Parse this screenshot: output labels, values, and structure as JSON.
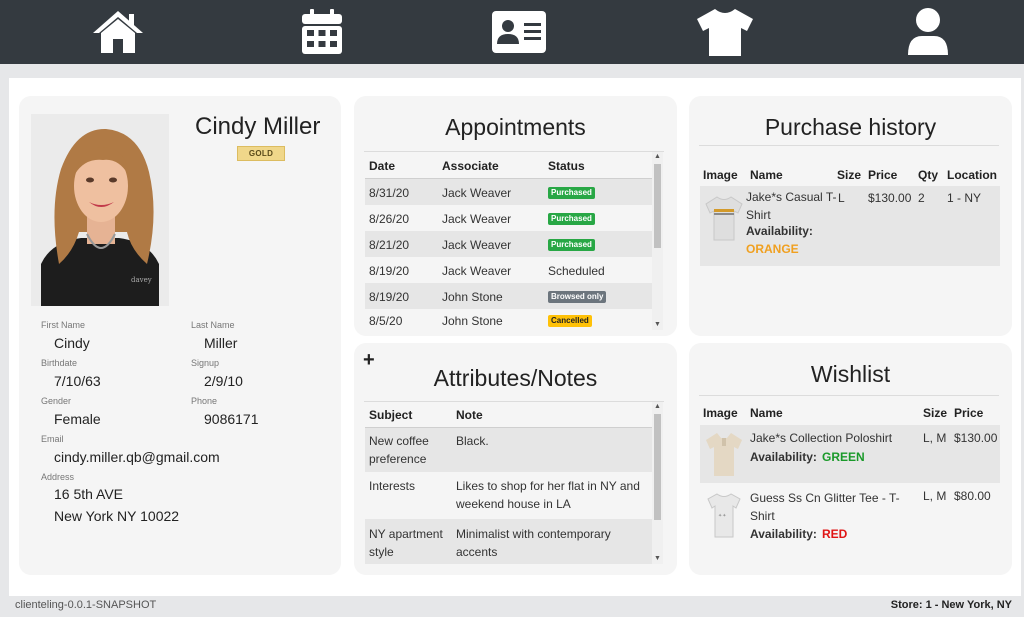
{
  "nav": {
    "items": [
      {
        "icon": "home-icon"
      },
      {
        "icon": "calendar-icon"
      },
      {
        "icon": "contact-card-icon"
      },
      {
        "icon": "tshirt-icon"
      },
      {
        "icon": "user-icon"
      }
    ]
  },
  "profile": {
    "full_name": "Cindy Miller",
    "tier": "GOLD",
    "photo_watermark": "davey",
    "fields": {
      "first_name_label": "First Name",
      "first_name": "Cindy",
      "last_name_label": "Last Name",
      "last_name": "Miller",
      "birthdate_label": "Birthdate",
      "birthdate": "7/10/63",
      "signup_label": "Signup",
      "signup": "2/9/10",
      "gender_label": "Gender",
      "gender": "Female",
      "phone_label": "Phone",
      "phone": "9086171",
      "email_label": "Email",
      "email": "cindy.miller.qb@gmail.com",
      "address_label": "Address",
      "address_line1": "16 5th AVE",
      "address_line2": "New York NY 10022"
    }
  },
  "appointments": {
    "title": "Appointments",
    "headers": {
      "date": "Date",
      "associate": "Associate",
      "status": "Status"
    },
    "rows": [
      {
        "date": "8/31/20",
        "associate": "Jack Weaver",
        "status": "Purchased"
      },
      {
        "date": "8/26/20",
        "associate": "Jack Weaver",
        "status": "Purchased"
      },
      {
        "date": "8/21/20",
        "associate": "Jack Weaver",
        "status": "Purchased"
      },
      {
        "date": "8/19/20",
        "associate": "Jack Weaver",
        "status": "Scheduled"
      },
      {
        "date": "8/19/20",
        "associate": "John Stone",
        "status": "Browsed only"
      },
      {
        "date": "8/5/20",
        "associate": "John Stone",
        "status": "Cancelled"
      }
    ]
  },
  "attributes": {
    "add_symbol": "+",
    "title": "Attributes/Notes",
    "headers": {
      "subject": "Subject",
      "note": "Note"
    },
    "rows": [
      {
        "subject": "New coffee preference",
        "note": "Black."
      },
      {
        "subject": "Interests",
        "note": "Likes to shop for her flat in NY and weekend house in LA"
      },
      {
        "subject": "NY apartment style",
        "note": "Minimalist with contemporary accents"
      }
    ]
  },
  "purchase_history": {
    "title": "Purchase history",
    "headers": {
      "image": "Image",
      "name": "Name",
      "size": "Size",
      "price": "Price",
      "qty": "Qty",
      "location": "Location"
    },
    "rows": [
      {
        "name": "Jake*s Casual T-Shirt",
        "availability_label": "Availability:",
        "availability": "ORANGE",
        "size": "L",
        "price": "$130.00",
        "qty": "2",
        "location": "1 - NY"
      }
    ]
  },
  "wishlist": {
    "title": "Wishlist",
    "headers": {
      "image": "Image",
      "name": "Name",
      "size": "Size",
      "price": "Price"
    },
    "rows": [
      {
        "name": "Jake*s Collection Poloshirt",
        "availability_label": "Availability:",
        "availability": "GREEN",
        "size": "L, M",
        "price": "$130.00"
      },
      {
        "name": "Guess Ss Cn Glitter Tee - T-Shirt",
        "availability_label": "Availability:",
        "availability": "RED",
        "size": "L, M",
        "price": "$80.00"
      }
    ]
  },
  "footer": {
    "version": "clienteling-0.0.1-SNAPSHOT",
    "store": "Store: 1 - New York, NY"
  },
  "colors": {
    "nav_bg": "#343a40",
    "purchased": "#28a745",
    "browsed": "#6c757d",
    "cancelled": "#ffc107",
    "orange": "#f0a020",
    "green": "#1a9a2a",
    "red": "#e01515"
  }
}
